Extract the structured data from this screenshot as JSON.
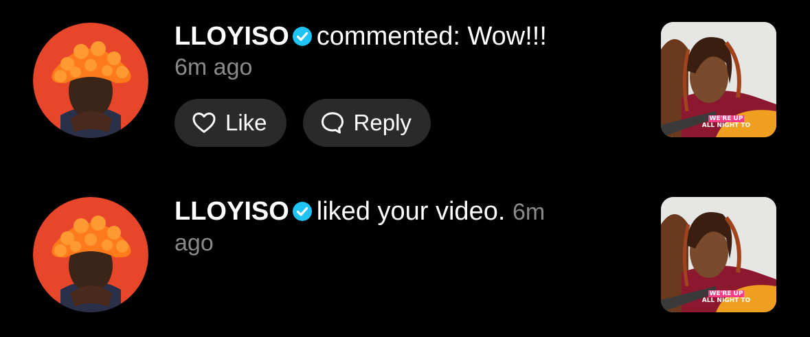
{
  "colors": {
    "background": "#000000",
    "text_primary": "#ffffff",
    "text_secondary": "#8a8a8a",
    "button_bg": "#2a2a2a",
    "verified_blue": "#20c4f4",
    "avatar_bg": "#e8462a"
  },
  "notifications": [
    {
      "username": "LLOYISO",
      "verified_icon": "verified-badge-icon",
      "action_text": "commented: Wow!!!",
      "time": "6m ago",
      "actions": [
        {
          "label": "Like",
          "icon": "heart-icon"
        },
        {
          "label": "Reply",
          "icon": "speech-bubble-icon"
        }
      ],
      "thumbnail_caption": {
        "line1": "WE'RE UP",
        "line2": "ALL NIGHT TO"
      }
    },
    {
      "username": "LLOYISO",
      "verified_icon": "verified-badge-icon",
      "action_text": "liked your video.",
      "time_part1": "6m",
      "time_part2": "ago",
      "thumbnail_caption": {
        "line1": "WE'RE UP",
        "line2": "ALL NIGHT TO"
      }
    }
  ]
}
